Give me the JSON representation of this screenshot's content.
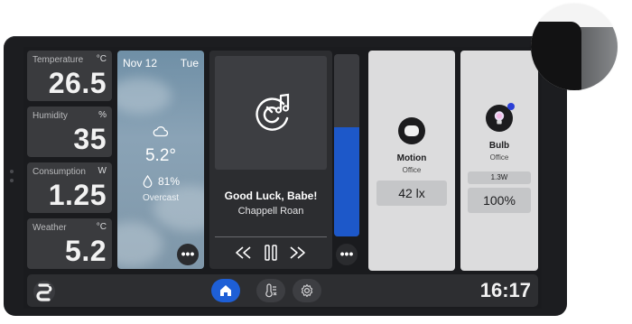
{
  "sensors": [
    {
      "label": "Temperature",
      "unit": "°C",
      "value": "26.5"
    },
    {
      "label": "Humidity",
      "unit": "%",
      "value": "35"
    },
    {
      "label": "Consumption",
      "unit": "W",
      "value": "1.25"
    },
    {
      "label": "Weather",
      "unit": "°C",
      "value": "5.2"
    }
  ],
  "weather": {
    "date": "Nov 12",
    "day": "Tue",
    "temperature": "5.2°",
    "humidity": "81%",
    "condition": "Overcast",
    "icon": "cloud-icon",
    "more": "•••"
  },
  "media": {
    "title": "Good Luck, Babe!",
    "artist": "Chappell Roan",
    "volume_level": 0.6,
    "controls": [
      "previous-icon",
      "pause-icon",
      "next-icon"
    ],
    "more": "•••"
  },
  "motion": {
    "name": "Motion",
    "room": "Office",
    "reading": "42 lx",
    "icon": "motion-sensor-icon"
  },
  "bulb": {
    "name": "Bulb",
    "room": "Office",
    "power": "1.3W",
    "brightness": "100%",
    "icon": "bulb-icon",
    "status_color": "#2b3fd6"
  },
  "nav": {
    "items": [
      "home-icon",
      "climate-icon",
      "settings-icon"
    ],
    "active": "home-icon"
  },
  "clock": "16:17",
  "colors": {
    "accent": "#1e5fd6",
    "volume": "#1d58c9"
  }
}
